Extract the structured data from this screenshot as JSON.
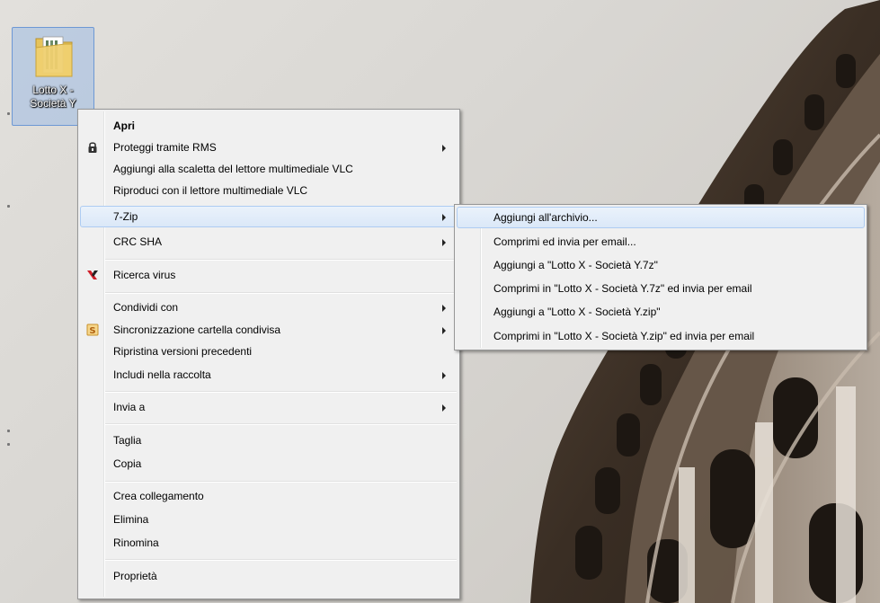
{
  "desktop_icon": {
    "label_line1": "Lotto X -",
    "label_line2": "Società Y"
  },
  "context_menu": {
    "items": [
      {
        "label": "Apri",
        "bold": true
      },
      {
        "label": "Proteggi tramite RMS",
        "icon": "lock-icon",
        "submenu": true
      },
      {
        "label": "Aggiungi alla scaletta del lettore multimediale VLC"
      },
      {
        "label": "Riproduci con il lettore multimediale VLC"
      },
      {
        "label": "7-Zip",
        "submenu": true,
        "highlighted": true
      },
      {
        "label": "CRC SHA",
        "submenu": true
      },
      {
        "label": "Ricerca virus",
        "icon": "kaspersky-icon"
      },
      {
        "label": "Condividi con",
        "submenu": true
      },
      {
        "label": "Sincronizzazione cartella condivisa",
        "icon": "sync-icon",
        "submenu": true
      },
      {
        "label": "Ripristina versioni precedenti"
      },
      {
        "label": "Includi nella raccolta",
        "submenu": true
      },
      {
        "label": "Invia a",
        "submenu": true
      },
      {
        "label": "Taglia"
      },
      {
        "label": "Copia"
      },
      {
        "label": "Crea collegamento"
      },
      {
        "label": "Elimina"
      },
      {
        "label": "Rinomina"
      },
      {
        "label": "Proprietà"
      }
    ]
  },
  "submenu_7zip": {
    "items": [
      {
        "label": "Aggiungi all'archivio...",
        "highlighted": true
      },
      {
        "label": "Comprimi ed invia per email..."
      },
      {
        "label": "Aggiungi a \"Lotto X - Società Y.7z\""
      },
      {
        "label": "Comprimi in \"Lotto X - Società Y.7z\" ed invia per email"
      },
      {
        "label": "Aggiungi a \"Lotto X - Società Y.zip\""
      },
      {
        "label": "Comprimi in \"Lotto X - Società Y.zip\" ed invia per email"
      }
    ]
  },
  "colors": {
    "menu_bg": "#f0f0f0",
    "highlight_border": "#aeccf2",
    "kaspersky_red": "#d0202a",
    "sync_orange": "#e8a020"
  }
}
